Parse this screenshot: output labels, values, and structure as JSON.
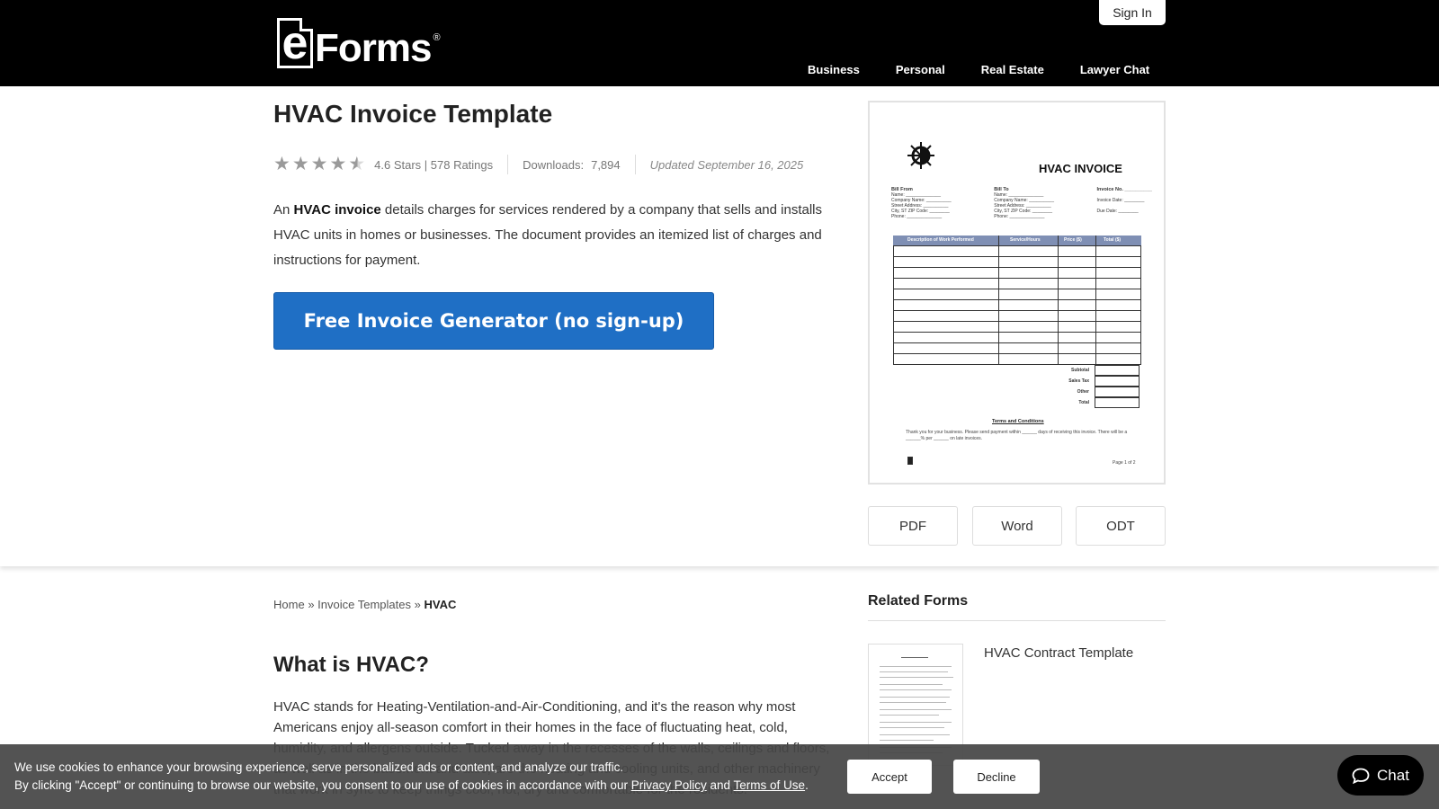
{
  "header": {
    "logo_e": "e",
    "logo_forms": "Forms",
    "logo_reg": "®",
    "sign_in": "Sign In",
    "nav": [
      "Business",
      "Personal",
      "Real Estate",
      "Lawyer Chat"
    ]
  },
  "hero": {
    "title": "HVAC Invoice Template",
    "rating_value": 4.6,
    "rating_text": "4.6 Stars | 578 Ratings",
    "downloads_label": "Downloads:",
    "downloads_value": "7,894",
    "updated": "Updated September 16, 2025",
    "intro_prefix": "An ",
    "intro_bold": "HVAC invoice",
    "intro_rest": " details charges for services rendered by a company that sells and installs HVAC units in homes or businesses. The document provides an itemized list of charges and instructions for payment.",
    "generator_button": "Free Invoice Generator (no sign-up)"
  },
  "preview": {
    "title": "HVAC INVOICE",
    "bill_from": "Bill From",
    "bill_to": "Bill To",
    "invoice_no": "Invoice No. __________",
    "invoice_date": "Invoice Date: ________",
    "due_date": "Due Date: ________",
    "fields": [
      "Name: ______________",
      "Company Name: __________",
      "Street Address: __________",
      "City, ST ZIP Code: ________",
      "Phone: ______________"
    ],
    "columns": [
      "Description of Work Performed",
      "Service/Hours",
      "Price ($)",
      "Total ($)"
    ],
    "totals": [
      "Subtotal",
      "Sales Tax",
      "Other",
      "Total"
    ],
    "terms_title": "Terms and Conditions",
    "terms_text": "Thank you for your business. Please send payment within ______ days of receiving this invoice. There will be a ______% per ______ on late invoices.",
    "page": "Page 1 of 2"
  },
  "formats": [
    "PDF",
    "Word",
    "ODT"
  ],
  "breadcrumb": {
    "home": "Home",
    "sep": "»",
    "section": "Invoice Templates",
    "current": "HVAC"
  },
  "article": {
    "heading": "What is HVAC?",
    "paragraph": "HVAC stands for Heating-Ventilation-and-Air-Conditioning, and it's the reason why most Americans enjoy all-season comfort in their homes in the face of fluctuating heat, cold, humidity, and allergens outside. Tucked away in the recesses of the walls, ceilings and floors, as well as in the basement and attic, are the heating and cooling units, and other machinery that work in sync to keep things cool, hot, dry and comfortable for the residents."
  },
  "related": {
    "title": "Related Forms",
    "items": [
      {
        "label": "HVAC Contract Template"
      }
    ]
  },
  "cookie": {
    "line1": "We use cookies to enhance your browsing experience, serve personalized ads or content, and analyze our traffic.",
    "line2_prefix": "By clicking \"Accept\" or continuing to browse our website, you consent to our use of cookies in accordance with our ",
    "privacy": "Privacy Policy",
    "and": " and ",
    "terms": "Terms of Use",
    "end": ".",
    "accept": "Accept",
    "decline": "Decline"
  },
  "chat": {
    "label": "Chat"
  }
}
